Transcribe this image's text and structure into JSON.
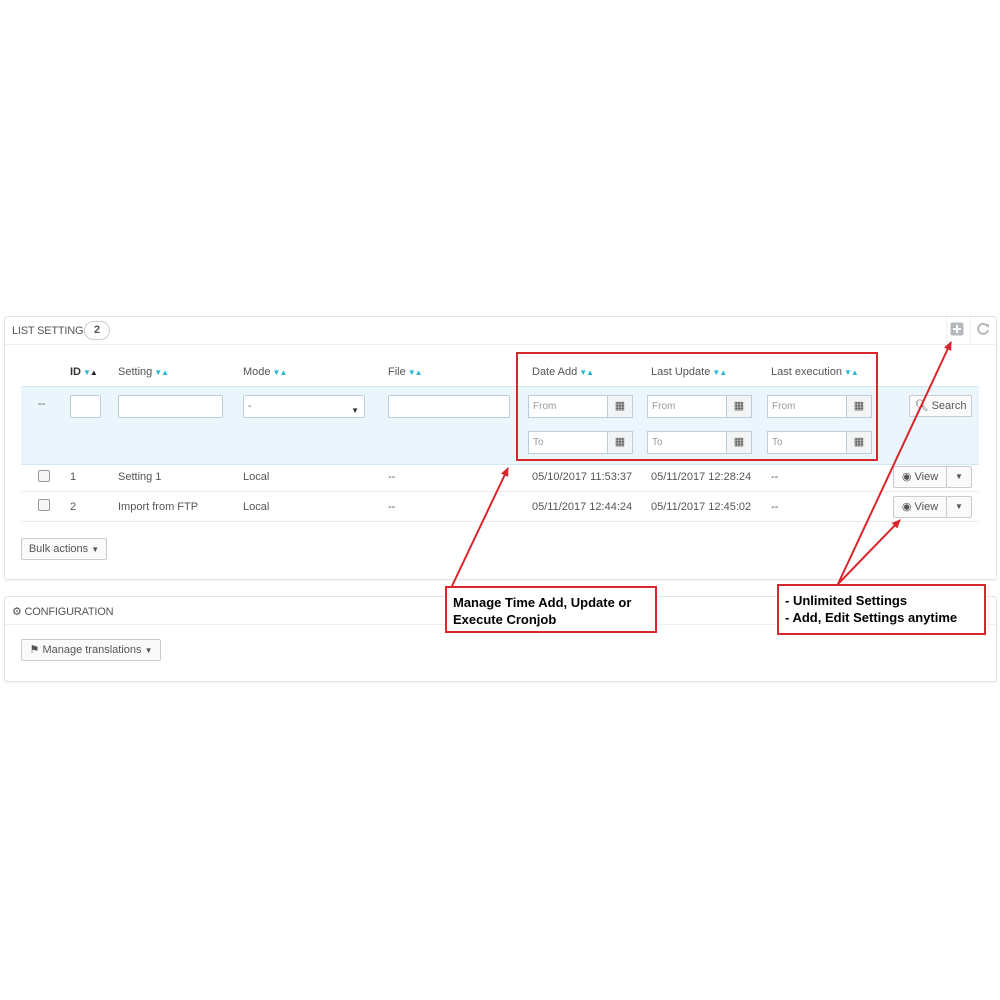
{
  "list_panel": {
    "title": "LIST SETTINGS",
    "count": "2",
    "add_icon": "plus-square-icon",
    "refresh_icon": "refresh-icon"
  },
  "columns": {
    "id": "ID",
    "setting": "Setting",
    "mode": "Mode",
    "file": "File",
    "date_add": "Date Add",
    "last_update": "Last Update",
    "last_execution": "Last execution"
  },
  "filters": {
    "empty_marker": "--",
    "mode_selected": "-",
    "from_placeholder": "From",
    "to_placeholder": "To",
    "search_label": "Search"
  },
  "rows": [
    {
      "id": "1",
      "setting": "Setting 1",
      "mode": "Local",
      "file": "--",
      "date_add": "05/10/2017 11:53:37",
      "last_update": "05/11/2017 12:28:24",
      "last_execution": "--",
      "view_label": "View"
    },
    {
      "id": "2",
      "setting": "Import from FTP",
      "mode": "Local",
      "file": "--",
      "date_add": "05/11/2017 12:44:24",
      "last_update": "05/11/2017 12:45:02",
      "last_execution": "--",
      "view_label": "View"
    }
  ],
  "bulk_actions_label": "Bulk actions",
  "config_panel": {
    "title": "CONFIGURATION",
    "manage_translations_label": "Manage translations"
  },
  "annotations": {
    "time_note_line1": "Manage Time Add, Update or",
    "time_note_line2": "Execute Cronjob",
    "settings_note_line1": "- Unlimited Settings",
    "settings_note_line2": "- Add, Edit Settings anytime",
    "accent_color": "#d9262d"
  },
  "colors": {
    "sort_arrow": "#25b9d7",
    "filter_band": "#eaf6fb"
  }
}
